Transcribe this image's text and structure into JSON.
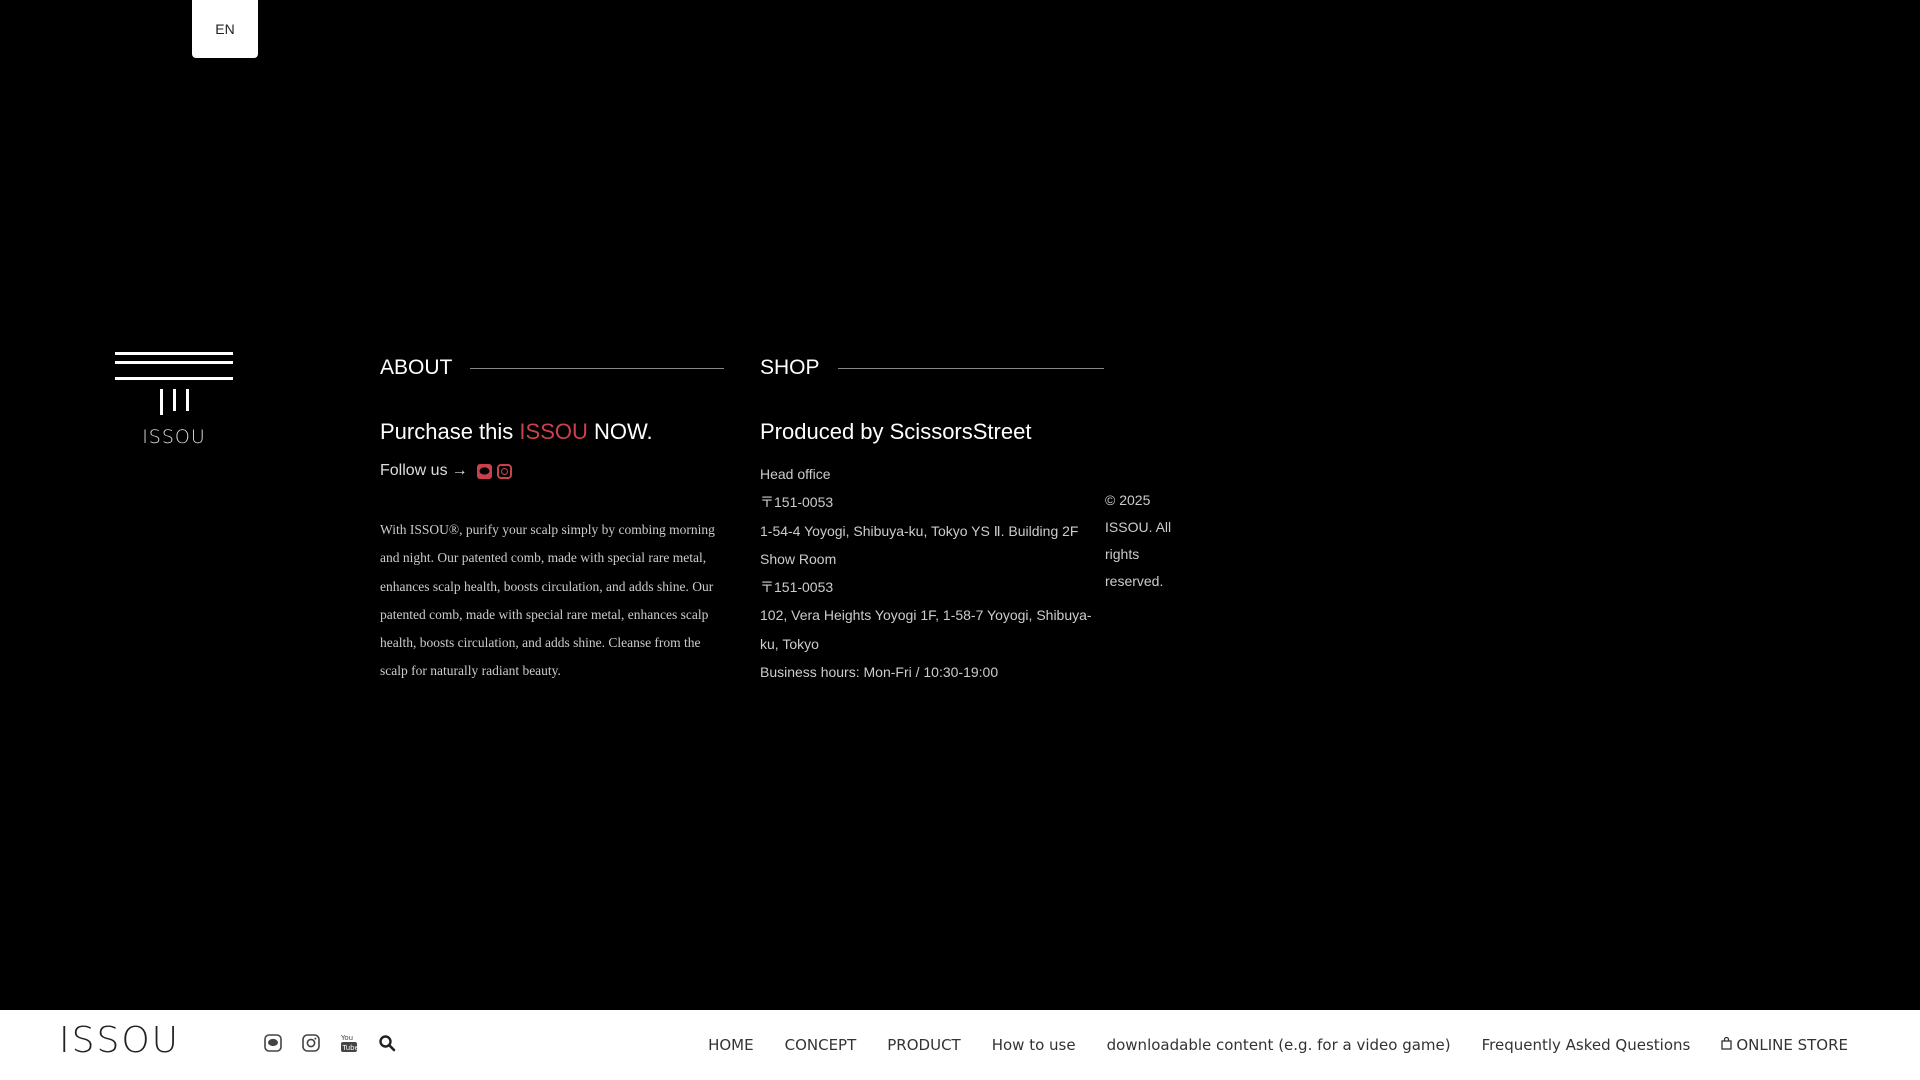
{
  "lang": {
    "label": "EN"
  },
  "footer": {
    "logo_text": "ISSOU",
    "about": {
      "heading": "ABOUT",
      "purchase_prefix": "Purchase this ",
      "purchase_brand": "ISSOU",
      "purchase_suffix": " NOW.",
      "follow_label": "Follow us",
      "follow_arrow": "→",
      "follow_icons": [
        "line-icon",
        "instagram-icon"
      ],
      "description": "With ISSOU®, purify your scalp simply by combing morning and night. Our patented comb, made with special rare metal, enhances scalp health, boosts circulation, and adds shine. Our patented comb, made with special rare metal, enhances scalp health, boosts circulation, and adds shine. Cleanse from the scalp for naturally radiant beauty."
    },
    "shop": {
      "heading": "SHOP",
      "producer": "Produced by ScissorsStreet",
      "lines": [
        "Head office",
        "〒151-0053",
        "1-54-4 Yoyogi, Shibuya-ku, Tokyo YS Ⅱ. Building 2F",
        "Show Room",
        "〒151-0053",
        "102, Vera Heights Yoyogi 1F, 1-58-7 Yoyogi, Shibuya-ku, Tokyo",
        "Business hours: Mon-Fri / 10:30-19:00"
      ]
    },
    "copyright": "© 2025 ISSOU. All rights reserved."
  },
  "navbar": {
    "logo_text": "ISSOU",
    "icons": [
      "line-icon",
      "instagram-icon",
      "youtube-icon",
      "search-icon"
    ],
    "links": {
      "home": "HOME",
      "concept": "CONCEPT",
      "product": "PRODUCT",
      "how_to_use": "How to use",
      "dlc": "downloadable content (e.g. for a video game)",
      "faq": "Frequently Asked Questions",
      "store": "ONLINE STORE"
    }
  },
  "colors": {
    "background": "#000000",
    "accent": "#c9414b",
    "navbar_bg": "#ffffff"
  }
}
